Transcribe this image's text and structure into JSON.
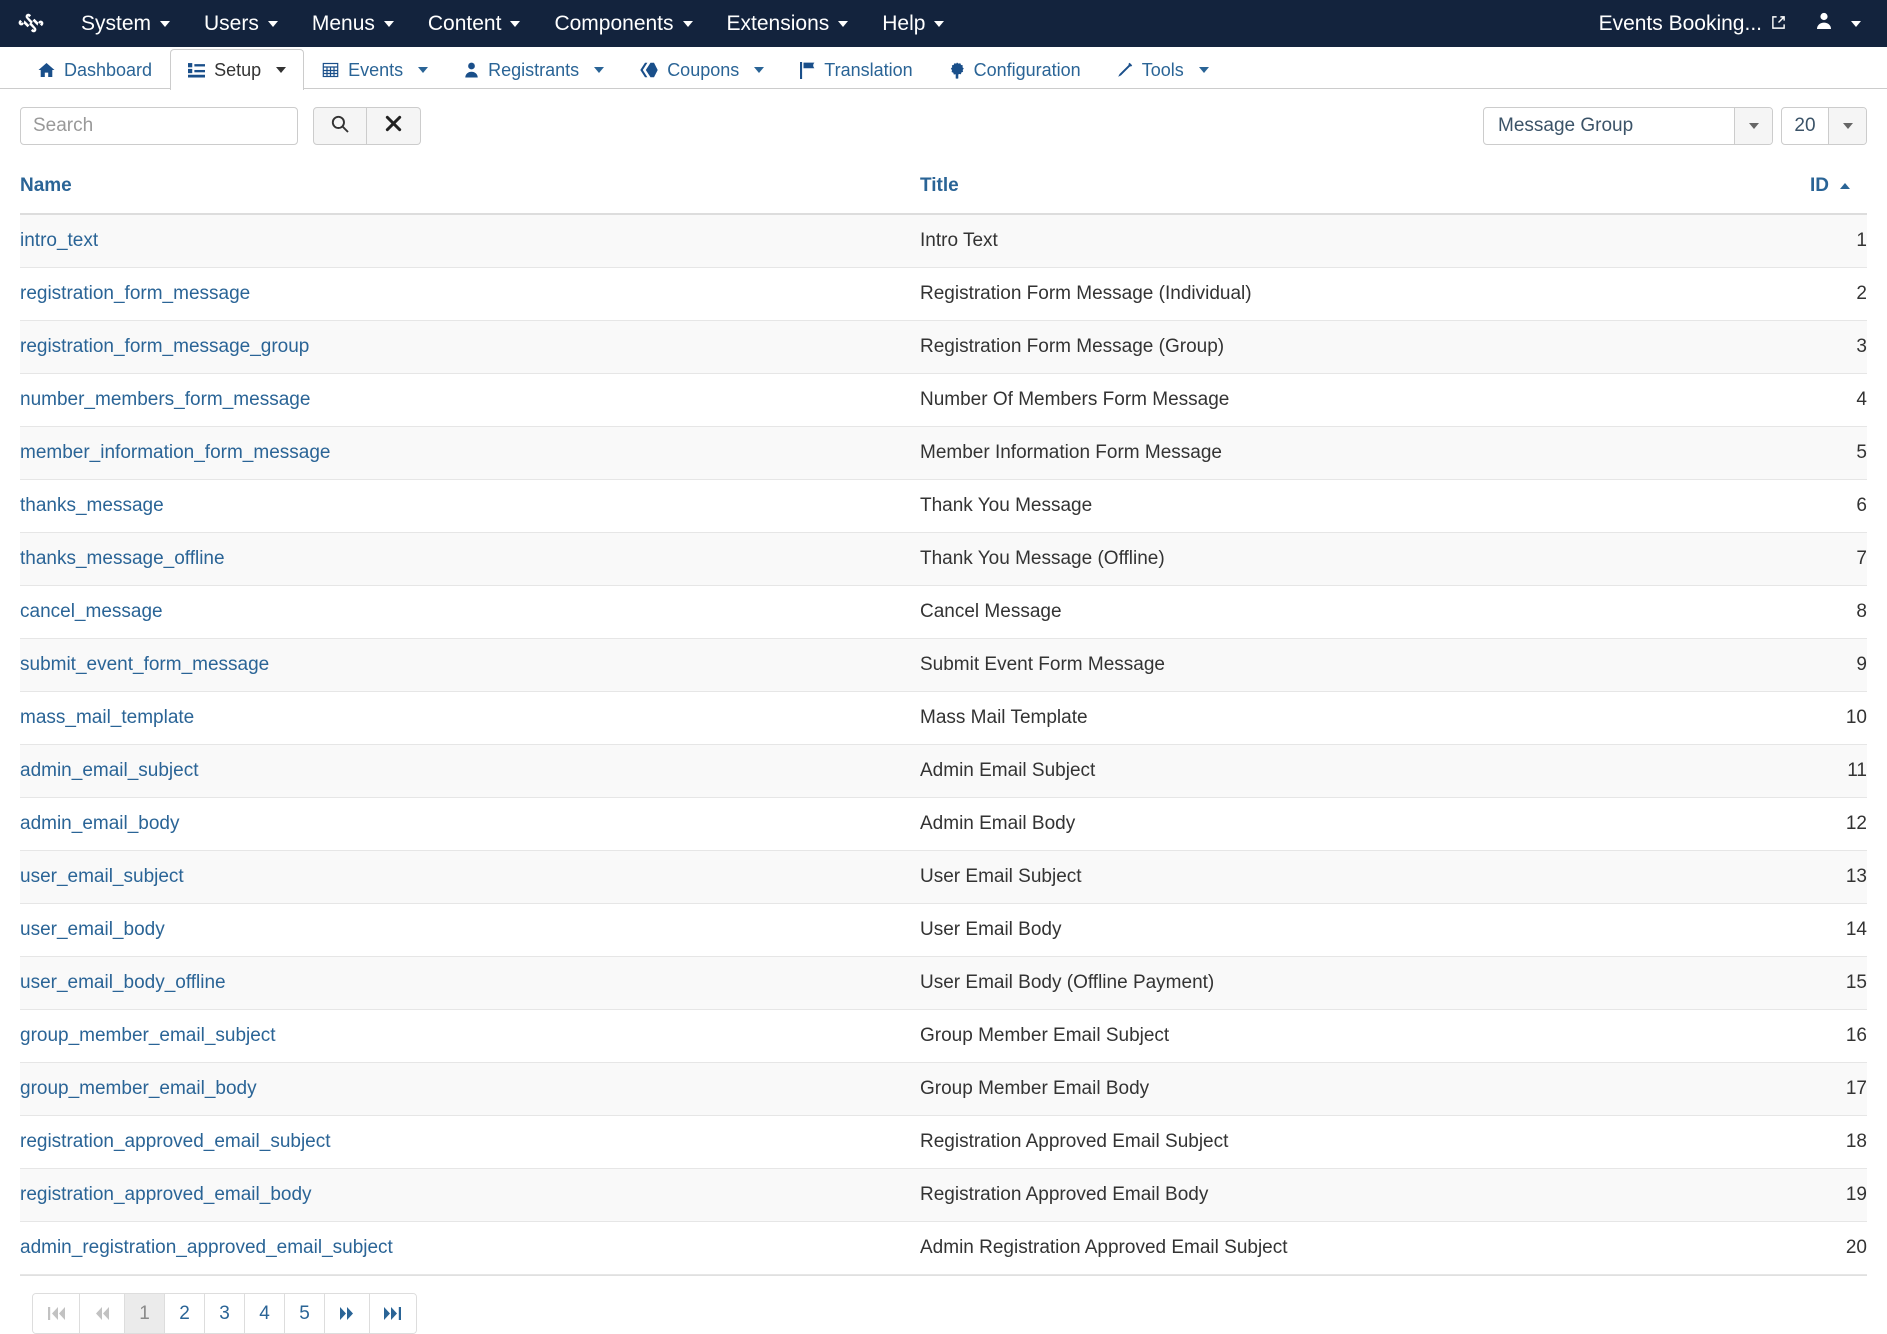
{
  "adminbar": {
    "logo_icon": "joomla-logo-icon",
    "menus": [
      {
        "label": "System",
        "has_caret": true
      },
      {
        "label": "Users",
        "has_caret": true
      },
      {
        "label": "Menus",
        "has_caret": true
      },
      {
        "label": "Content",
        "has_caret": true
      },
      {
        "label": "Components",
        "has_caret": true
      },
      {
        "label": "Extensions",
        "has_caret": true
      },
      {
        "label": "Help",
        "has_caret": true
      }
    ],
    "site_link": "Events Booking...",
    "site_link_icon": "external-link-icon",
    "user_icon": "user-icon"
  },
  "subnav": {
    "items": [
      {
        "label": "Dashboard",
        "icon": "home-icon",
        "has_caret": false,
        "active": false
      },
      {
        "label": "Setup",
        "icon": "list-icon",
        "has_caret": true,
        "active": true
      },
      {
        "label": "Events",
        "icon": "calendar-icon",
        "has_caret": true,
        "active": false
      },
      {
        "label": "Registrants",
        "icon": "user-icon",
        "has_caret": true,
        "active": false
      },
      {
        "label": "Coupons",
        "icon": "tag-icon",
        "has_caret": true,
        "active": false
      },
      {
        "label": "Translation",
        "icon": "flag-icon",
        "has_caret": false,
        "active": false
      },
      {
        "label": "Configuration",
        "icon": "gear-icon",
        "has_caret": false,
        "active": false
      },
      {
        "label": "Tools",
        "icon": "wrench-icon",
        "has_caret": true,
        "active": false
      }
    ]
  },
  "toolbar": {
    "search_placeholder": "Search",
    "search_value": "",
    "search_button_icon": "search-icon",
    "clear_button_icon": "close-icon",
    "filter_group_value": "Message Group",
    "list_limit_value": "20"
  },
  "table": {
    "columns": [
      {
        "key": "name",
        "label": "Name",
        "sorted": false
      },
      {
        "key": "title",
        "label": "Title",
        "sorted": false
      },
      {
        "key": "id",
        "label": "ID",
        "sorted": true,
        "sort_dir": "asc"
      }
    ],
    "rows": [
      {
        "name": "intro_text",
        "title": "Intro Text",
        "id": "1"
      },
      {
        "name": "registration_form_message",
        "title": "Registration Form Message (Individual)",
        "id": "2"
      },
      {
        "name": "registration_form_message_group",
        "title": "Registration Form Message (Group)",
        "id": "3"
      },
      {
        "name": "number_members_form_message",
        "title": "Number Of Members Form Message",
        "id": "4"
      },
      {
        "name": "member_information_form_message",
        "title": "Member Information Form Message",
        "id": "5"
      },
      {
        "name": "thanks_message",
        "title": "Thank You Message",
        "id": "6"
      },
      {
        "name": "thanks_message_offline",
        "title": "Thank You Message (Offline)",
        "id": "7"
      },
      {
        "name": "cancel_message",
        "title": "Cancel Message",
        "id": "8"
      },
      {
        "name": "submit_event_form_message",
        "title": "Submit Event Form Message",
        "id": "9"
      },
      {
        "name": "mass_mail_template",
        "title": "Mass Mail Template",
        "id": "10"
      },
      {
        "name": "admin_email_subject",
        "title": "Admin Email Subject",
        "id": "11"
      },
      {
        "name": "admin_email_body",
        "title": "Admin Email Body",
        "id": "12"
      },
      {
        "name": "user_email_subject",
        "title": "User Email Subject",
        "id": "13"
      },
      {
        "name": "user_email_body",
        "title": "User Email Body",
        "id": "14"
      },
      {
        "name": "user_email_body_offline",
        "title": "User Email Body (Offline Payment)",
        "id": "15"
      },
      {
        "name": "group_member_email_subject",
        "title": "Group Member Email Subject",
        "id": "16"
      },
      {
        "name": "group_member_email_body",
        "title": "Group Member Email Body",
        "id": "17"
      },
      {
        "name": "registration_approved_email_subject",
        "title": "Registration Approved Email Subject",
        "id": "18"
      },
      {
        "name": "registration_approved_email_body",
        "title": "Registration Approved Email Body",
        "id": "19"
      },
      {
        "name": "admin_registration_approved_email_subject",
        "title": "Admin Registration Approved Email Subject",
        "id": "20"
      }
    ]
  },
  "pagination": {
    "items": [
      {
        "label": "",
        "icon": "first-page-icon",
        "state": "disabled"
      },
      {
        "label": "",
        "icon": "prev-page-icon",
        "state": "disabled"
      },
      {
        "label": "1",
        "icon": "",
        "state": "active"
      },
      {
        "label": "2",
        "icon": "",
        "state": "normal"
      },
      {
        "label": "3",
        "icon": "",
        "state": "normal"
      },
      {
        "label": "4",
        "icon": "",
        "state": "normal"
      },
      {
        "label": "5",
        "icon": "",
        "state": "normal"
      },
      {
        "label": "",
        "icon": "next-page-icon",
        "state": "normal"
      },
      {
        "label": "",
        "icon": "last-page-icon",
        "state": "normal"
      }
    ]
  },
  "colors": {
    "adminbar_bg": "#13233d",
    "link_blue": "#2a6496",
    "row_stripe": "#f9f9f9",
    "active_page_bg": "#ebebeb"
  }
}
